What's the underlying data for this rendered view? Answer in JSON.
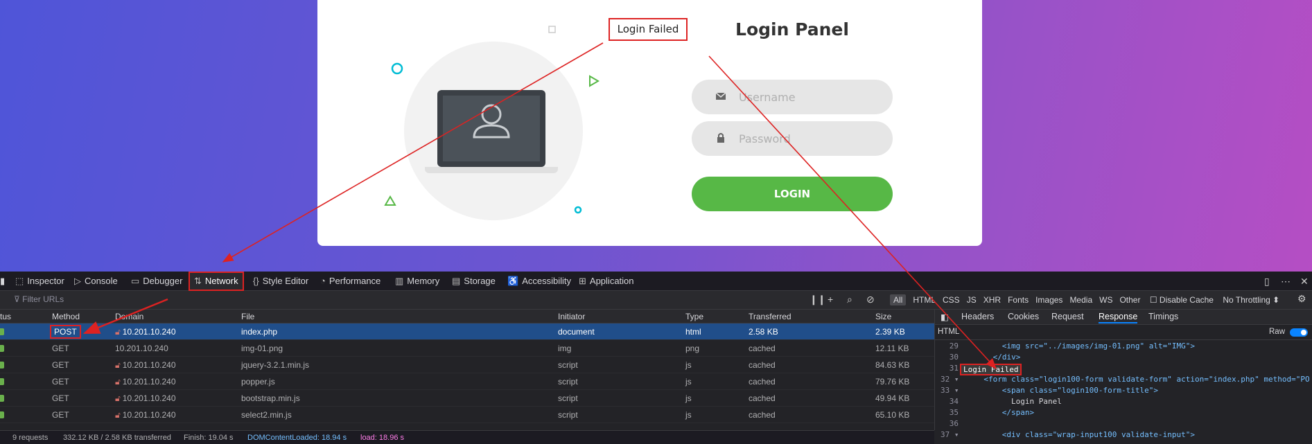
{
  "login": {
    "title": "Login Panel",
    "username_placeholder": "Username",
    "password_placeholder": "Password",
    "button_label": "LOGIN",
    "failed_message": "Login Failed"
  },
  "devtools": {
    "tabs": [
      {
        "icon": "inspector-icon",
        "label": "Inspector"
      },
      {
        "icon": "console-icon",
        "label": "Console"
      },
      {
        "icon": "debugger-icon",
        "label": "Debugger"
      },
      {
        "icon": "network-icon",
        "label": "Network"
      },
      {
        "icon": "style-editor-icon",
        "label": "Style Editor"
      },
      {
        "icon": "performance-icon",
        "label": "Performance"
      },
      {
        "icon": "memory-icon",
        "label": "Memory"
      },
      {
        "icon": "storage-icon",
        "label": "Storage"
      },
      {
        "icon": "accessibility-icon",
        "label": "Accessibility"
      },
      {
        "icon": "application-icon",
        "label": "Application"
      }
    ],
    "filter_placeholder": "Filter URLs",
    "type_filters": [
      "All",
      "HTML",
      "CSS",
      "JS",
      "XHR",
      "Fonts",
      "Images",
      "Media",
      "WS",
      "Other"
    ],
    "disable_cache_label": "Disable Cache",
    "throttling_label": "No Throttling ⬍",
    "columns": [
      "tus",
      "Method",
      "Domain",
      "File",
      "Initiator",
      "Type",
      "Transferred",
      "Size"
    ],
    "requests": [
      {
        "method": "POST",
        "domain": "10.201.10.240",
        "file": "index.php",
        "initiator": "document",
        "type": "html",
        "transferred": "2.58 KB",
        "size": "2.39 KB"
      },
      {
        "method": "GET",
        "domain": "10.201.10.240",
        "file": "img-01.png",
        "initiator": "img",
        "type": "png",
        "transferred": "cached",
        "size": "12.11 KB"
      },
      {
        "method": "GET",
        "domain": "10.201.10.240",
        "file": "jquery-3.2.1.min.js",
        "initiator": "script",
        "type": "js",
        "transferred": "cached",
        "size": "84.63 KB"
      },
      {
        "method": "GET",
        "domain": "10.201.10.240",
        "file": "popper.js",
        "initiator": "script",
        "type": "js",
        "transferred": "cached",
        "size": "79.76 KB"
      },
      {
        "method": "GET",
        "domain": "10.201.10.240",
        "file": "bootstrap.min.js",
        "initiator": "script",
        "type": "js",
        "transferred": "cached",
        "size": "49.94 KB"
      },
      {
        "method": "GET",
        "domain": "10.201.10.240",
        "file": "select2.min.js",
        "initiator": "script",
        "type": "js",
        "transferred": "cached",
        "size": "65.10 KB"
      }
    ],
    "status": {
      "requests": "9 requests",
      "transferred": "332.12 KB / 2.58 KB transferred",
      "finish": "Finish: 19.04 s",
      "dom_loaded": "DOMContentLoaded: 18.94 s",
      "load": "load: 18.96 s"
    },
    "side_tabs": [
      "Headers",
      "Cookies",
      "Request",
      "Response",
      "Timings"
    ],
    "side_active": "Response",
    "response_mode": "HTML",
    "raw_label": "Raw",
    "code_lines": [
      {
        "n": "29",
        "indent": "        ",
        "text": "<img src=\"../images/img-01.png\" alt=\"IMG\">"
      },
      {
        "n": "30",
        "indent": "      ",
        "text": "</div>"
      },
      {
        "n": "31",
        "indent": "",
        "text": "Login Failed"
      },
      {
        "n": "32 ▾",
        "indent": "    ",
        "text": "<form class=\"login100-form validate-form\" action=\"index.php\" method=\"PO"
      },
      {
        "n": "33 ▾",
        "indent": "        ",
        "text": "<span class=\"login100-form-title\">"
      },
      {
        "n": "34",
        "indent": "          ",
        "text": "Login Panel"
      },
      {
        "n": "35",
        "indent": "        ",
        "text": "</span>"
      },
      {
        "n": "36",
        "indent": "",
        "text": ""
      },
      {
        "n": "37 ▾",
        "indent": "        ",
        "text": "<div class=\"wrap-input100 validate-input\">"
      }
    ]
  }
}
